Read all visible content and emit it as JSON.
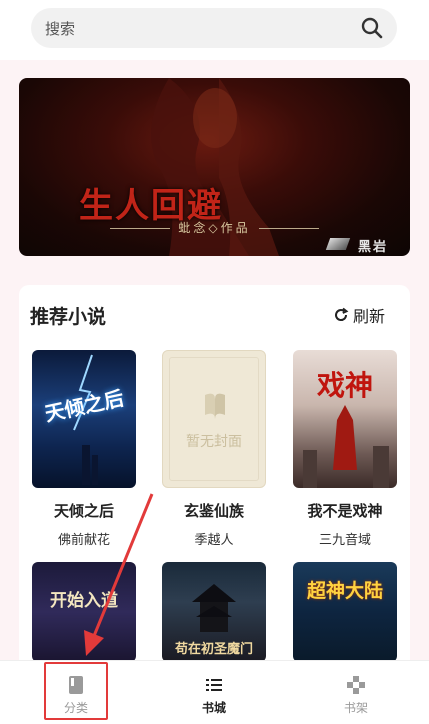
{
  "search": {
    "placeholder": "搜索"
  },
  "banner": {
    "title": "生人回避",
    "author_line": "蚍念◇作品",
    "publisher": "黑岩"
  },
  "recommend": {
    "title": "推荐小说",
    "refresh_label": "刷新",
    "books": [
      {
        "title": "天倾之后",
        "author": "佛前献花",
        "cover_text": "天倾之后"
      },
      {
        "title": "玄鉴仙族",
        "author": "季越人",
        "cover_text": "暂无封面"
      },
      {
        "title": "我不是戏神",
        "author": "三九音域",
        "cover_text": "戏神"
      },
      {
        "title": "开始入道",
        "author": "",
        "cover_text": "开始入道"
      },
      {
        "title": "苟在初圣魔门",
        "author": "",
        "cover_text": "苟在初圣魔门"
      },
      {
        "title": "超神大陆",
        "author": "",
        "cover_text": "超神大陆"
      }
    ]
  },
  "tabbar": {
    "tabs": [
      {
        "label": "分类",
        "icon": "book-icon",
        "color": "#9a9a9a"
      },
      {
        "label": "书城",
        "icon": "list-icon",
        "color": "#222222"
      },
      {
        "label": "书架",
        "icon": "puzzle-icon",
        "color": "#9a9a9a"
      }
    ]
  },
  "colors": {
    "highlight": "#e23a3a",
    "page_bg": "#fdf3f5"
  }
}
